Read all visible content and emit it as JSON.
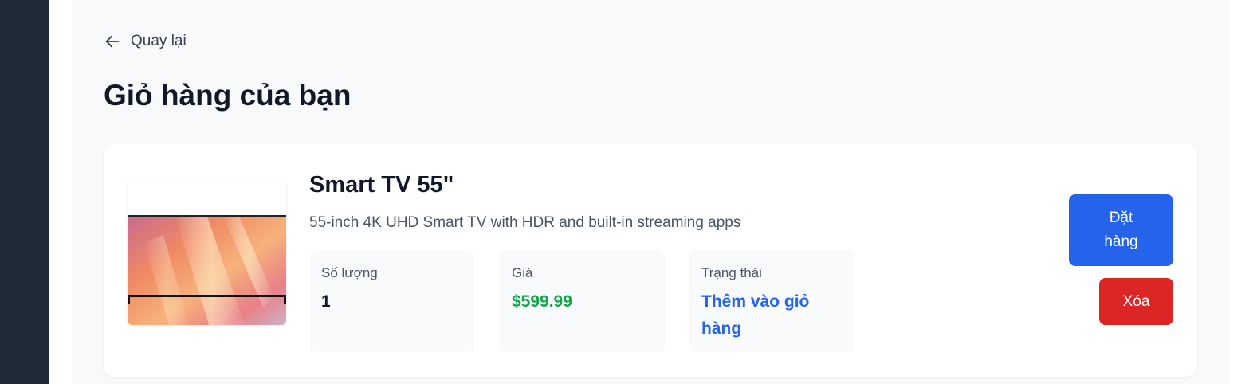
{
  "nav": {
    "back_label": "Quay lại"
  },
  "page": {
    "title": "Giỏ hàng của bạn"
  },
  "cart_item": {
    "name": "Smart TV 55\"",
    "description": "55-inch 4K UHD Smart TV with HDR and built-in streaming apps",
    "quantity_label": "Số lượng",
    "quantity_value": "1",
    "price_label": "Giá",
    "price_value": "$599.99",
    "status_label": "Trạng thái",
    "status_value": "Thêm vào giỏ hàng",
    "order_button": "Đặt hàng",
    "delete_button": "Xóa"
  },
  "colors": {
    "sidebar": "#1f2937",
    "price": "#16a34a",
    "status": "#2563eb",
    "order_button": "#2563eb",
    "delete_button": "#dc2626"
  },
  "icons": {
    "back": "arrow-left-icon"
  }
}
